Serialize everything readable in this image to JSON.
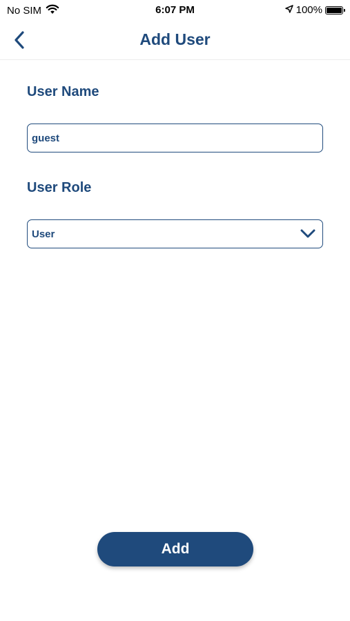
{
  "status_bar": {
    "carrier": "No SIM",
    "time": "6:07 PM",
    "battery": "100%",
    "icons": [
      "wifi-icon",
      "location-icon",
      "battery-icon"
    ]
  },
  "nav": {
    "title": "Add User",
    "back_icon": "chevron-left-icon"
  },
  "form": {
    "username_label": "User Name",
    "username_value": "guest",
    "role_label": "User Role",
    "role_value": "User",
    "role_icon": "chevron-down-icon"
  },
  "actions": {
    "add_label": "Add"
  },
  "colors": {
    "primary": "#1f4a7c",
    "background": "#ffffff",
    "divider": "#ececec"
  }
}
